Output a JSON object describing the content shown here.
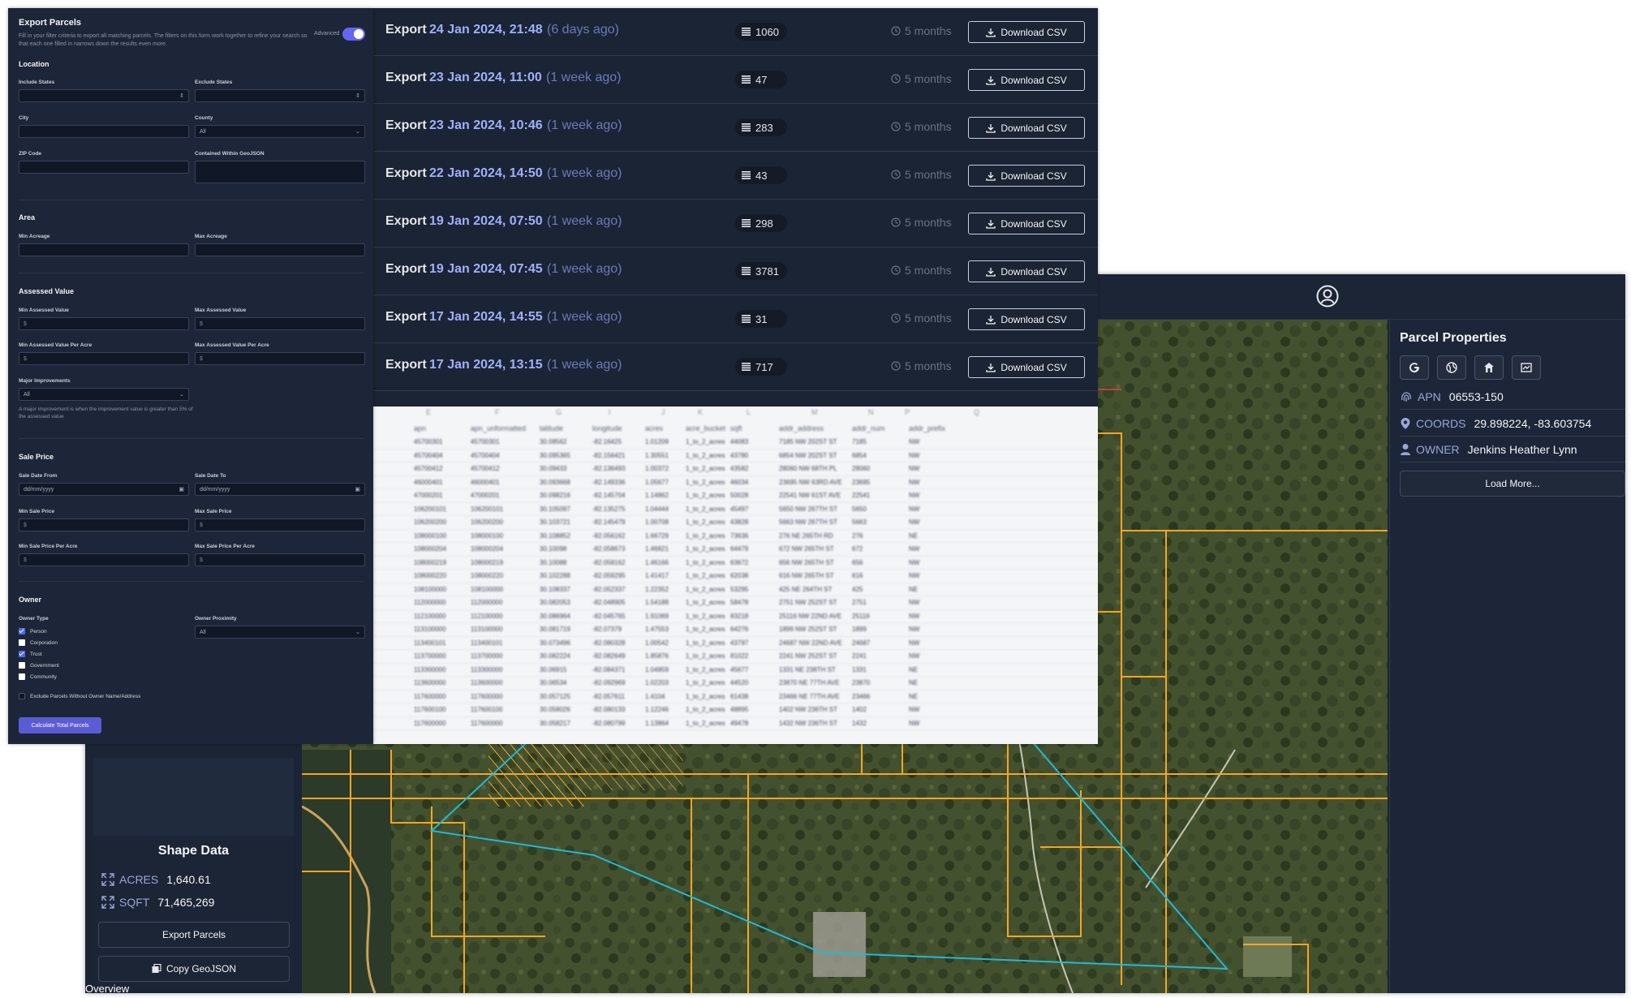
{
  "colors": {
    "accent": "#6366f1",
    "parcel_line": "#f59e0b",
    "selection_line": "#22b8d8",
    "panel_bg": "#1b2434"
  },
  "export_form": {
    "title": "Export Parcels",
    "description": "Fill in your filter criteria to export all matching parcels. The filters on this form work together to refine your search so that each one filled in narrows down the results even more.",
    "advanced_label": "Advanced",
    "advanced_on": true,
    "sections": {
      "location": "Location",
      "area": "Area",
      "assessed_value": "Assessed Value",
      "sale_price": "Sale Price",
      "owner": "Owner"
    },
    "fields": {
      "include_states": "Include States",
      "exclude_states": "Exclude States",
      "city": "City",
      "county": "County",
      "county_value": "All",
      "zip_code": "ZIP Code",
      "contained_geojson": "Contained Within GeoJSON",
      "min_acreage": "Min Acreage",
      "max_acreage": "Max Acreage",
      "min_assessed": "Min Assessed Value",
      "max_assessed": "Max Assessed Value",
      "min_assessed_acre": "Min Assessed Value Per Acre",
      "max_assessed_acre": "Max Assessed Value Per Acre",
      "major_improvements": "Major Improvements",
      "major_improvements_value": "All",
      "major_note": "A major improvement is when the improvement value is greater than 5% of the assessed value",
      "sale_date_from": "Sale Date From",
      "sale_date_to": "Sale Date To",
      "date_placeholder": "dd/mm/yyyy",
      "min_sale": "Min Sale Price",
      "max_sale": "Max Sale Price",
      "min_sale_acre": "Min Sale Price Per Acre",
      "max_sale_acre": "Max Sale Price Per Acre",
      "owner_type": "Owner Type",
      "owner_proximity": "Owner Proximity",
      "owner_proximity_value": "All",
      "currency_symbol": "$"
    },
    "owner_types": [
      {
        "label": "Person",
        "checked": true
      },
      {
        "label": "Corporation",
        "checked": false
      },
      {
        "label": "Trust",
        "checked": true
      },
      {
        "label": "Government",
        "checked": false
      },
      {
        "label": "Community",
        "checked": false
      }
    ],
    "exclude_no_owner": "Exclude Parcels Without Owner Name/Address",
    "calculate_button": "Calculate Total Parcels"
  },
  "exports": {
    "word": "Export",
    "download_label": "Download CSV",
    "rows": [
      {
        "date": "24 Jan 2024, 21:48",
        "ago": "(6 days ago)",
        "count": "1060",
        "age": "5 months"
      },
      {
        "date": "23 Jan 2024, 11:00",
        "ago": "(1 week ago)",
        "count": "47",
        "age": "5 months"
      },
      {
        "date": "23 Jan 2024, 10:46",
        "ago": "(1 week ago)",
        "count": "283",
        "age": "5 months"
      },
      {
        "date": "22 Jan 2024, 14:50",
        "ago": "(1 week ago)",
        "count": "43",
        "age": "5 months"
      },
      {
        "date": "19 Jan 2024, 07:50",
        "ago": "(1 week ago)",
        "count": "298",
        "age": "5 months"
      },
      {
        "date": "19 Jan 2024, 07:45",
        "ago": "(1 week ago)",
        "count": "3781",
        "age": "5 months"
      },
      {
        "date": "17 Jan 2024, 14:55",
        "ago": "(1 week ago)",
        "count": "31",
        "age": "5 months"
      },
      {
        "date": "17 Jan 2024, 13:15",
        "ago": "(1 week ago)",
        "count": "717",
        "age": "5 months"
      }
    ]
  },
  "spreadsheet": {
    "column_letters": [
      "E",
      "F",
      "G",
      "I",
      "J",
      "K",
      "L",
      "M",
      "N",
      "P",
      "Q"
    ],
    "column_names": [
      "apn",
      "apn_unformatted",
      "latitude",
      "longitude",
      "acres",
      "acre_bucket",
      "sqft",
      "addr_address",
      "addr_num",
      "addr_prefix"
    ],
    "rows": [
      [
        "45700301",
        "45700301",
        "30.08562",
        "-82.16425",
        "1.01209",
        "1_to_2_acres",
        "44083",
        "7185 NW 202ST ST",
        "7185",
        "NW"
      ],
      [
        "45700404",
        "45700404",
        "30.095365",
        "-82.156421",
        "1.30551",
        "1_to_2_acres",
        "43780",
        "6854 NW 202ST ST",
        "6854",
        "NW"
      ],
      [
        "45700412",
        "45700412",
        "30.09433",
        "-82.136493",
        "1.00372",
        "1_to_2_acres",
        "43582",
        "28060 NW 68TH PL",
        "28060",
        "NW"
      ],
      [
        "46000401",
        "46000401",
        "30.093668",
        "-82.149336",
        "1.05677",
        "1_to_2_acres",
        "46034",
        "23695 NW 63RD AVE",
        "23695",
        "NW"
      ],
      [
        "47000201",
        "47000201",
        "30.098216",
        "-82.145704",
        "1.14862",
        "1_to_2_acres",
        "50028",
        "22541 NW 61ST AVE",
        "22541",
        "NW"
      ],
      [
        "106200101",
        "106200101",
        "30.105097",
        "-82.135275",
        "1.04444",
        "1_to_2_acres",
        "45497",
        "5650 NW 267TH ST",
        "5650",
        "NW"
      ],
      [
        "106200200",
        "106200200",
        "30.103721",
        "-82.145479",
        "1.00708",
        "1_to_2_acres",
        "43828",
        "5663 NW 267TH ST",
        "5663",
        "NW"
      ],
      [
        "108000100",
        "108000100",
        "30.108852",
        "-82.056162",
        "1.66729",
        "1_to_2_acres",
        "73636",
        "276 NE 265TH RD",
        "276",
        "NE"
      ],
      [
        "108000204",
        "108000204",
        "30.10098",
        "-82.058673",
        "1.46821",
        "1_to_2_acres",
        "64479",
        "672 NW 265TH ST",
        "672",
        "NW"
      ],
      [
        "108000219",
        "108000219",
        "30.10088",
        "-82.058162",
        "1.46166",
        "1_to_2_acres",
        "63672",
        "656 NW 265TH ST",
        "656",
        "NW"
      ],
      [
        "108000220",
        "108000220",
        "30.102288",
        "-82.059295",
        "1.41417",
        "1_to_2_acres",
        "62038",
        "616 NW 265TH ST",
        "616",
        "NW"
      ],
      [
        "108100000",
        "108100000",
        "30.108337",
        "-82.052337",
        "1.22352",
        "1_to_2_acres",
        "53295",
        "425 NE 264TH ST",
        "425",
        "NE"
      ],
      [
        "112000000",
        "112000000",
        "30.082053",
        "-82.048905",
        "1.54188",
        "1_to_2_acres",
        "58478",
        "2751 NW 252ST ST",
        "2751",
        "NW"
      ],
      [
        "112100000",
        "112100000",
        "30.086964",
        "-82.045765",
        "1.91069",
        "1_to_2_acres",
        "83218",
        "25116 NW 22ND AVE",
        "25116",
        "NW"
      ],
      [
        "113100000",
        "113100000",
        "30.081719",
        "-82.07379",
        "1.47553",
        "1_to_2_acres",
        "64276",
        "1899 NW 252ST ST",
        "1899",
        "NW"
      ],
      [
        "113400101",
        "113400101",
        "30.073496",
        "-82.080328",
        "1.00542",
        "1_to_2_acres",
        "43797",
        "24687 NW 22ND AVE",
        "24687",
        "NW"
      ],
      [
        "113700000",
        "113700000",
        "30.082224",
        "-82.082649",
        "1.85876",
        "1_to_2_acres",
        "81022",
        "2241 NW 252ST ST",
        "2241",
        "NW"
      ],
      [
        "113300000",
        "113300000",
        "30.06915",
        "-82.084371",
        "1.04859",
        "1_to_2_acres",
        "45677",
        "1331 NE 238TH ST",
        "1331",
        "NE"
      ],
      [
        "113600000",
        "113600000",
        "30.06534",
        "-82.092969",
        "1.02203",
        "1_to_2_acres",
        "44520",
        "23870 NE 77TH AVE",
        "23870",
        "NE"
      ],
      [
        "117600000",
        "117600000",
        "30.057125",
        "-82.057611",
        "1.4104",
        "1_to_2_acres",
        "61438",
        "23466 NE 77TH AVE",
        "23466",
        "NE"
      ],
      [
        "117600100",
        "117600100",
        "30.058026",
        "-82.080133",
        "1.12246",
        "1_to_2_acres",
        "48895",
        "1402 NW 236TH ST",
        "1402",
        "NW"
      ],
      [
        "117600000",
        "117600000",
        "30.058217",
        "-82.080799",
        "1.13864",
        "1_to_2_acres",
        "49478",
        "1432 NW 236TH ST",
        "1432",
        "NW"
      ]
    ]
  },
  "map": {
    "parcel_panel": {
      "title": "Parcel Properties",
      "apn_label": "APN",
      "apn_value": "06553-150",
      "coords_label": "COORDS",
      "coords_value": "29.898224, -83.603754",
      "owner_label": "OWNER",
      "owner_value": "Jenkins Heather Lynn",
      "load_more": "Load More..."
    },
    "shape_data": {
      "title": "Shape Data",
      "acres_label": "ACRES",
      "acres_value": "1,640.61",
      "sqft_label": "SQFT",
      "sqft_value": "71,465,269",
      "export_button": "Export Parcels",
      "copy_button": "Copy GeoJSON"
    },
    "overview_label": "Overview"
  }
}
